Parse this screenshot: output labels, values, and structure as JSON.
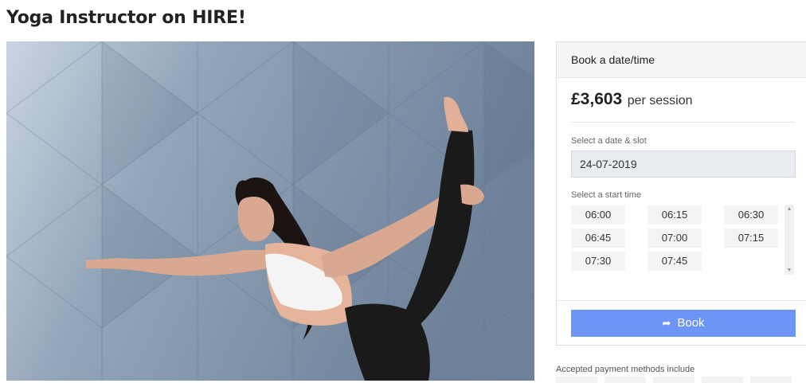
{
  "page": {
    "title": "Yoga Instructor on HIRE!"
  },
  "booking": {
    "header": "Book a date/time",
    "price": "£3,603",
    "price_unit": "per session",
    "date_label": "Select a date & slot",
    "date_value": "24-07-2019",
    "time_label": "Select a start time",
    "slots": [
      "06:00",
      "06:15",
      "06:30",
      "06:45",
      "07:00",
      "07:15",
      "07:30",
      "07:45"
    ],
    "book_label": "Book",
    "accent_color": "#6d95f7"
  },
  "payment": {
    "label": "Accepted payment methods include"
  },
  "icons": {
    "book": "share-arrow-icon",
    "scroll_up": "scroll-up-icon",
    "scroll_down": "scroll-down-icon"
  }
}
